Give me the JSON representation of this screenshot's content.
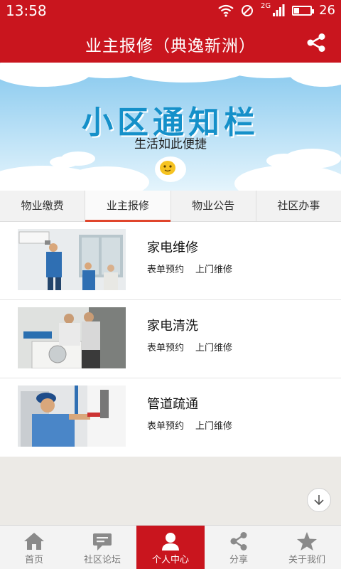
{
  "status_bar": {
    "time": "13:58",
    "network": "2G",
    "battery": "26"
  },
  "title_bar": {
    "title": "业主报修（典逸新洲）",
    "share_icon": "share-icon"
  },
  "banner": {
    "headline": "小区通知栏",
    "subtitle": "生活如此便捷"
  },
  "tabs": [
    {
      "label": "物业缴费",
      "active": false
    },
    {
      "label": "业主报修",
      "active": true
    },
    {
      "label": "物业公告",
      "active": false
    },
    {
      "label": "社区办事",
      "active": false
    }
  ],
  "services": [
    {
      "name": "家电维修",
      "link1": "表单预约",
      "link2": "上门维修"
    },
    {
      "name": "家电清洗",
      "link1": "表单预约",
      "link2": "上门维修"
    },
    {
      "name": "管道疏通",
      "link1": "表单预约",
      "link2": "上门维修"
    }
  ],
  "bottom_nav": [
    {
      "label": "首页",
      "icon": "home-icon",
      "active": false
    },
    {
      "label": "社区论坛",
      "icon": "chat-icon",
      "active": false
    },
    {
      "label": "个人中心",
      "icon": "person-icon",
      "active": true
    },
    {
      "label": "分享",
      "icon": "share-icon",
      "active": false
    },
    {
      "label": "关于我们",
      "icon": "star-icon",
      "active": false
    }
  ],
  "colors": {
    "primary": "#c9151e",
    "tab_indicator": "#e0452c",
    "headline": "#1590c9"
  }
}
